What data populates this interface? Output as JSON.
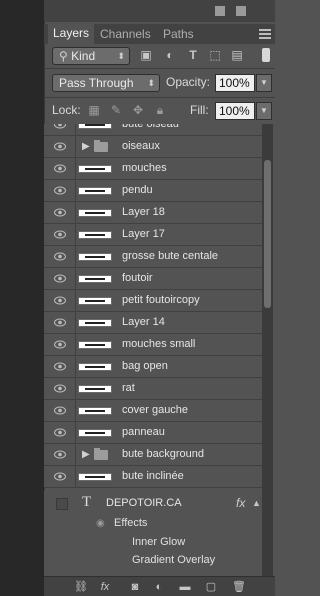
{
  "tabs": [
    "Layers",
    "Channels",
    "Paths"
  ],
  "filter": {
    "kind_label": "Kind"
  },
  "blend": {
    "mode": "Pass Through",
    "opacity_label": "Opacity:",
    "opacity_value": "100%"
  },
  "lock": {
    "label": "Lock:",
    "fill_label": "Fill:",
    "fill_value": "100%"
  },
  "layers": [
    {
      "name": "bute oiseau",
      "kind": "thumb"
    },
    {
      "name": "oiseaux",
      "kind": "group"
    },
    {
      "name": "mouches",
      "kind": "thumb"
    },
    {
      "name": "pendu",
      "kind": "thumb"
    },
    {
      "name": "Layer 18",
      "kind": "thumb"
    },
    {
      "name": "Layer 17",
      "kind": "thumb"
    },
    {
      "name": "grosse bute centale",
      "kind": "thumb"
    },
    {
      "name": "foutoir",
      "kind": "thumb"
    },
    {
      "name": "petit foutoircopy",
      "kind": "thumb"
    },
    {
      "name": "Layer 14",
      "kind": "thumb"
    },
    {
      "name": "mouches small",
      "kind": "thumb"
    },
    {
      "name": "bag open",
      "kind": "thumb"
    },
    {
      "name": "rat",
      "kind": "thumb"
    },
    {
      "name": "cover gauche",
      "kind": "thumb"
    },
    {
      "name": "panneau",
      "kind": "thumb"
    },
    {
      "name": "bute background",
      "kind": "group"
    },
    {
      "name": "bute inclinée",
      "kind": "thumb"
    }
  ],
  "text_layer": {
    "type_glyph": "T",
    "name": "DEPOTOIR.CA",
    "fx_badge": "fx",
    "effects_label": "Effects",
    "effects": [
      "Inner Glow",
      "Gradient Overlay"
    ]
  },
  "bottom_icons": [
    "link-icon",
    "fx-icon",
    "mask-icon",
    "adjustment-icon",
    "group-icon",
    "new-layer-icon",
    "trash-icon"
  ],
  "bottom_fx": "fx"
}
